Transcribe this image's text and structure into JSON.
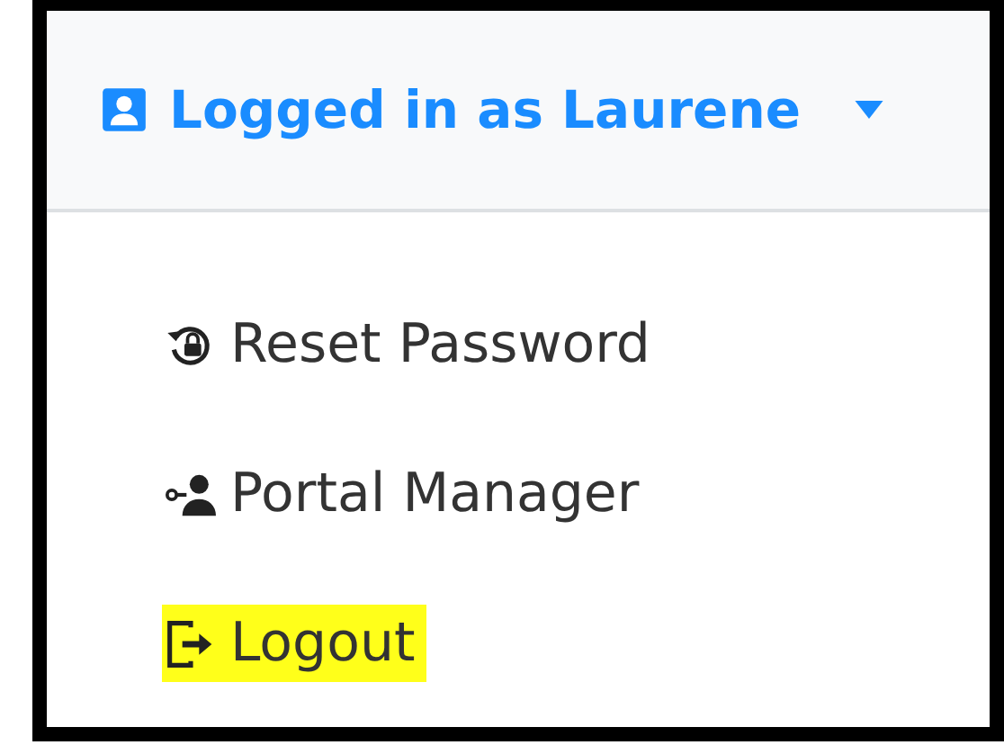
{
  "dropdown": {
    "title": "Logged in as Laurene",
    "expanded": true,
    "items": [
      {
        "kind": "reset",
        "label": "Reset Password",
        "highlighted": false
      },
      {
        "kind": "portal",
        "label": "Portal Manager",
        "highlighted": false
      },
      {
        "kind": "logout",
        "label": "Logout",
        "highlighted": true
      }
    ]
  }
}
